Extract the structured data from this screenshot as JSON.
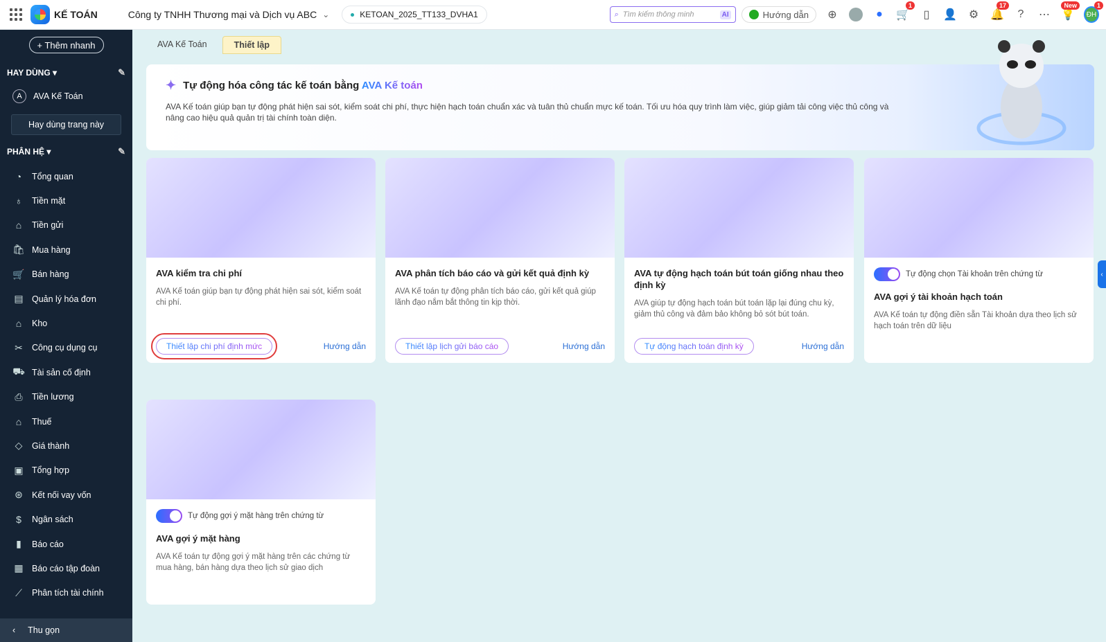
{
  "topbar": {
    "brand": "KẾ TOÁN",
    "company": "Công ty TNHH Thương mại và Dịch vụ ABC",
    "database": "KETOAN_2025_TT133_DVHA1",
    "search_placeholder": "Tìm kiếm thông minh",
    "ai": "AI",
    "guide": "Hướng dẫn",
    "cart_badge": "1",
    "bell_badge": "17",
    "new_badge": "New",
    "avatar": "ĐH",
    "avatar_badge": "1"
  },
  "sidebar": {
    "quick_add": "+ Thêm nhanh",
    "frequent": "HAY DÙNG",
    "ava_item": "AVA Kế Toán",
    "ava_letter": "A",
    "favorite_btn": "Hay dùng trang này",
    "modules": "PHÂN HỆ",
    "items": [
      {
        "label": "Tổng quan",
        "icon": "◔"
      },
      {
        "label": "Tiền mặt",
        "icon": "♁"
      },
      {
        "label": "Tiền gửi",
        "icon": "⌂"
      },
      {
        "label": "Mua hàng",
        "icon": "🛍"
      },
      {
        "label": "Bán hàng",
        "icon": "🛒"
      },
      {
        "label": "Quản lý hóa đơn",
        "icon": "▤"
      },
      {
        "label": "Kho",
        "icon": "⌂"
      },
      {
        "label": "Công cụ dụng cụ",
        "icon": "✂"
      },
      {
        "label": "Tài sản cố định",
        "icon": "⛟"
      },
      {
        "label": "Tiền lương",
        "icon": "⎙"
      },
      {
        "label": "Thuế",
        "icon": "⌂"
      },
      {
        "label": "Giá thành",
        "icon": "◇"
      },
      {
        "label": "Tổng hợp",
        "icon": "▣"
      },
      {
        "label": "Kết nối vay vốn",
        "icon": "⊛"
      },
      {
        "label": "Ngân sách",
        "icon": "$"
      },
      {
        "label": "Báo cáo",
        "icon": "▮"
      },
      {
        "label": "Báo cáo tập đoàn",
        "icon": "▦"
      },
      {
        "label": "Phân tích tài chính",
        "icon": "⟋"
      }
    ],
    "collapse": "Thu gọn"
  },
  "tabs": [
    "AVA Kế Toán",
    "Thiết lập"
  ],
  "hero": {
    "title": "Tự động hóa công tác kế toán bằng ",
    "title_highlight": "AVA Kế toán",
    "desc": "AVA Kế toán giúp bạn tự động phát hiện sai sót, kiểm soát chi phí, thực hiện hạch toán chuẩn xác và tuân thủ chuẩn mực kế toán. Tối ưu hóa quy trình làm việc, giúp giảm tải công việc thủ công và nâng cao hiệu quả quản trị tài chính toàn diện."
  },
  "cards": [
    {
      "title": "AVA kiểm tra chi phí",
      "desc": "AVA Kế toán giúp bạn tự động phát hiện sai sót, kiểm soát chi phí.",
      "button": "Thiết lập chi phí định mức",
      "link": "Hướng dẫn"
    },
    {
      "title": "AVA phân tích báo cáo và gửi kết quả định kỳ",
      "desc": "AVA Kế toán tự động phân tích báo cáo, gửi kết quả giúp lãnh đạo nắm bắt thông tin kịp thời.",
      "button": "Thiết lập lịch gửi báo cáo",
      "link": "Hướng dẫn"
    },
    {
      "title": "AVA tự động hạch toán bút toán giống nhau theo định kỳ",
      "desc": "AVA giúp tự động hạch toán bút toán lặp lại đúng chu kỳ, giảm thủ công và đảm bảo không bỏ sót bút toán.",
      "button": "Tự động hạch toán định kỳ",
      "link": "Hướng dẫn"
    },
    {
      "toggle": "Tự động chọn Tài khoản trên chứng từ",
      "toggle_on": true,
      "title": "AVA gợi ý tài khoản hạch toán",
      "desc": "AVA Kế toán tự động điền sẵn Tài khoản dựa theo lịch sử hạch toán trên dữ liệu"
    },
    {
      "toggle": "Tự động gợi ý mặt hàng trên chứng từ",
      "toggle_on": true,
      "title": "AVA gợi ý mặt hàng",
      "desc": "AVA Kế toán tự động gợi ý mặt hàng trên các chứng từ mua hàng, bán hàng dựa theo lịch sử giao dịch"
    }
  ]
}
